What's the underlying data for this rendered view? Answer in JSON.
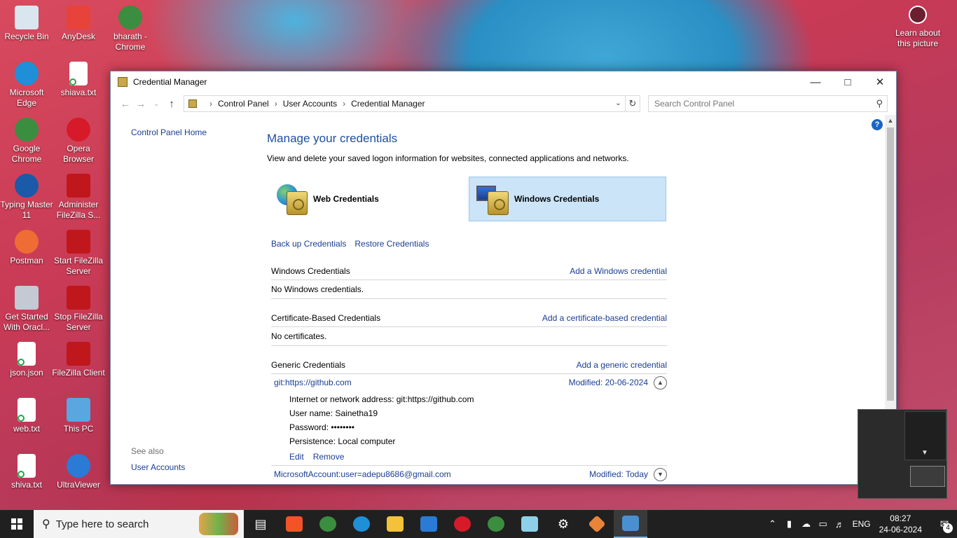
{
  "desktop": {
    "icons": [
      {
        "label": "Recycle Bin",
        "color": "#d9e6ef"
      },
      {
        "label": "AnyDesk",
        "color": "#e8433a"
      },
      {
        "label": "bharath - Chrome",
        "color": "#3b8d3f"
      },
      {
        "label": "Microsoft Edge",
        "color": "#1f8fd8"
      },
      {
        "label": "shiava.txt",
        "color": "#ffffff"
      },
      {
        "label": "Google Chrome",
        "color": "#3b8d3f"
      },
      {
        "label": "Opera Browser",
        "color": "#d61a2a"
      },
      {
        "label": "Typing Master 11",
        "color": "#1a5aa8"
      },
      {
        "label": "Administer FileZilla S...",
        "color": "#c0171c"
      },
      {
        "label": "Postman",
        "color": "#ef6c34"
      },
      {
        "label": "Start FileZilla Server",
        "color": "#c0171c"
      },
      {
        "label": "Get Started With Oracl...",
        "color": "#c4c9d4"
      },
      {
        "label": "Stop FileZilla Server",
        "color": "#c0171c"
      },
      {
        "label": "json.json",
        "color": "#ffffff"
      },
      {
        "label": "FileZilla Client",
        "color": "#c0171c"
      },
      {
        "label": "web.txt",
        "color": "#ffffff"
      },
      {
        "label": "This PC",
        "color": "#5aa6e0"
      },
      {
        "label": "shiva.txt",
        "color": "#ffffff"
      },
      {
        "label": "UltraViewer",
        "color": "#2a7ad6"
      }
    ],
    "learn_label": "Learn about this picture"
  },
  "window": {
    "title": "Credential Manager",
    "breadcrumbs": [
      "Control Panel",
      "User Accounts",
      "Credential Manager"
    ],
    "search_placeholder": "Search Control Panel",
    "left": {
      "home": "Control Panel Home",
      "see_also": "See also",
      "user_accounts": "User Accounts"
    },
    "heading": "Manage your credentials",
    "description": "View and delete your saved logon information for websites, connected applications and networks.",
    "tiles": {
      "web": "Web Credentials",
      "windows": "Windows Credentials"
    },
    "links": {
      "backup": "Back up Credentials",
      "restore": "Restore Credentials"
    },
    "sections": {
      "windows": {
        "title": "Windows Credentials",
        "add": "Add a Windows credential",
        "empty": "No Windows credentials."
      },
      "certificate": {
        "title": "Certificate-Based Credentials",
        "add": "Add a certificate-based credential",
        "empty": "No certificates."
      },
      "generic": {
        "title": "Generic Credentials",
        "add": "Add a generic credential"
      }
    },
    "entries": [
      {
        "name": "git:https://github.com",
        "modified": "Modified:  20-06-2024",
        "expanded": true,
        "address": "Internet or network address:  git:https://github.com",
        "username": "User name:  Sainetha19",
        "password": "Password:  ••••••••",
        "persistence": "Persistence:  Local computer",
        "edit": "Edit",
        "remove": "Remove"
      },
      {
        "name": "MicrosoftAccount:user=adepu8686@gmail.com",
        "modified": "Modified:  Today",
        "expanded": false
      }
    ]
  },
  "taskbar": {
    "search_placeholder": "Type here to search",
    "lang": "ENG",
    "time": "08:27",
    "date": "24-06-2024",
    "notifications": "4"
  }
}
